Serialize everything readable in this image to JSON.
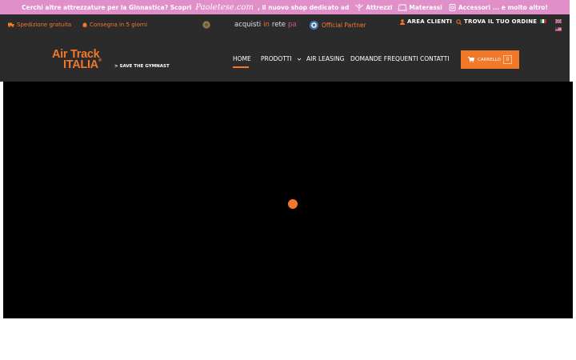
{
  "promo": {
    "text_before": "Cerchi altre attrezzature per la Ginnastica? Scopri",
    "brand": "Paoletese.com",
    "text_after": ", il nuovo shop dedicato ad",
    "items": [
      "Attrezzi",
      "Materassi",
      "Accessori ... e molto altro!"
    ],
    "color": "#e08fc9"
  },
  "topbar": {
    "shipping": "Spedizione gratuita",
    "delivery": "Consegna in 5 giorni",
    "acquisti_1": "acquisti",
    "acquisti_2": "in",
    "acquisti_3": "rete",
    "acquisti_4": "pa",
    "official_partner": "Official Partner",
    "area_clienti": "AREA CLIENTI",
    "trova_ordine": "TROVA IL TUO ORDINE",
    "flags": [
      "italian-flag-icon",
      "english-flag-icon",
      "usa-flag-icon"
    ]
  },
  "header": {
    "logo_line1": "Air Track",
    "logo_line2": "ITALIA",
    "logo_mark": "®",
    "tagline": "> SAVE THE GYMNAST",
    "nav": [
      "HOME",
      "PRODOTTI",
      "AIR LEASING",
      "DOMANDE FREQUENTI",
      "CONTATTI"
    ],
    "active_nav": "HOME",
    "cart_label": "CARRELLO",
    "cart_count": "0"
  },
  "colors": {
    "accent": "#f2782a",
    "dark_bar": "#2b2b2b",
    "video_bg": "#000000"
  }
}
